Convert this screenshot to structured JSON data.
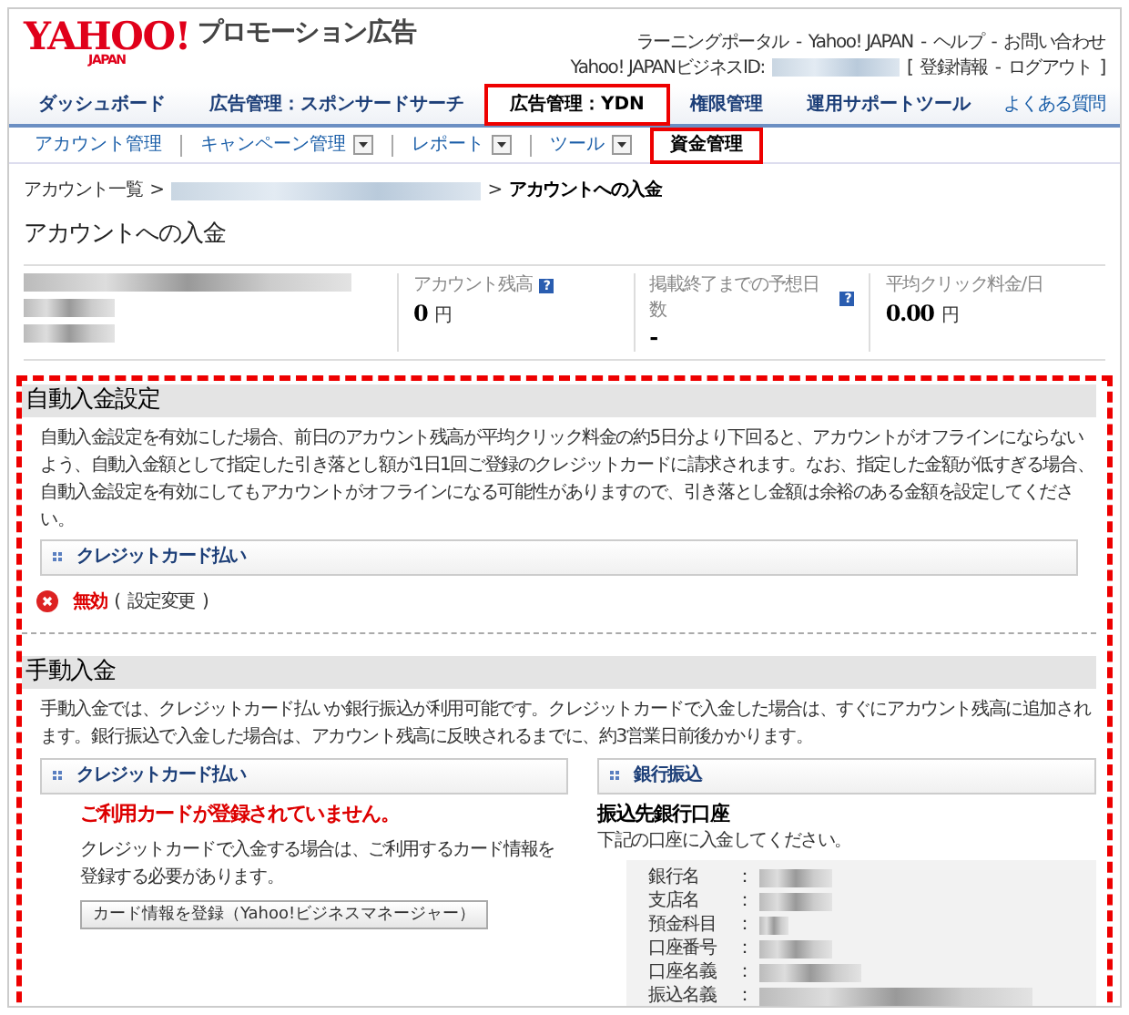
{
  "header": {
    "logo": "YAHOO!",
    "logo_sub": "JAPAN",
    "product": "プロモーション広告",
    "links": [
      {
        "text": "ラーニングポータル"
      },
      {
        "text": "Yahoo! JAPAN"
      },
      {
        "text": "ヘルプ"
      },
      {
        "text": "お問い合わせ"
      }
    ],
    "link_separator": "-",
    "business_id_label": "Yahoo! JAPANビジネスID:",
    "account_links": [
      {
        "text": "登録情報"
      },
      {
        "text": "ログアウト"
      }
    ],
    "bracket_open": "[",
    "bracket_close": "]"
  },
  "tabs": [
    {
      "label": "ダッシュボード",
      "selected": false,
      "highlighted": false
    },
    {
      "label": "広告管理：スポンサードサーチ",
      "selected": false,
      "highlighted": false
    },
    {
      "label": "広告管理：YDN",
      "selected": true,
      "highlighted": true
    },
    {
      "label": "権限管理",
      "selected": false,
      "highlighted": false
    },
    {
      "label": "運用サポートツール",
      "selected": false,
      "highlighted": false
    }
  ],
  "faq": "よくある質問",
  "subtabs": [
    {
      "label": "アカウント管理",
      "dropdown": false,
      "selected": false,
      "highlighted": false
    },
    {
      "label": "キャンペーン管理",
      "dropdown": true,
      "selected": false,
      "highlighted": false
    },
    {
      "label": "レポート",
      "dropdown": true,
      "selected": false,
      "highlighted": false
    },
    {
      "label": "ツール",
      "dropdown": true,
      "selected": false,
      "highlighted": false
    },
    {
      "label": "資金管理",
      "dropdown": false,
      "selected": true,
      "highlighted": true
    }
  ],
  "breadcrumb": [
    {
      "text": "アカウント一覧",
      "kind": "link"
    },
    {
      "kind": "redacted"
    },
    {
      "text": "アカウントへの入金",
      "kind": "current"
    }
  ],
  "breadcrumb_separator": ">",
  "page_title": "アカウントへの入金",
  "stats": [
    {
      "label": "アカウント残高",
      "help": "?",
      "value": "0",
      "unit": "円"
    },
    {
      "label": "掲載終了までの予想日数",
      "help": "?",
      "value": "-"
    },
    {
      "label": "平均クリック料金/日",
      "value": "0.00",
      "unit": "円"
    }
  ],
  "auto_deposit": {
    "heading": "自動入金設定",
    "text": "自動入金設定を有効にした場合、前日のアカウント残高が平均クリック料金の約5日分より下回ると、アカウントがオフラインにならないよう、自動入金額として指定した引き落とし額が1日1回ご登録のクレジットカードに請求されます。なお、指定した金額が低すぎる場合、自動入金設定を有効にしてもアカウントがオフラインになる可能性がありますので、引き落とし金額は余裕のある金額を設定してください。",
    "panel_title": "クレジットカード払い",
    "enabled": false,
    "status": "無効",
    "link_open": "(",
    "link": "設定変更",
    "link_close": ")"
  },
  "manual_deposit": {
    "heading": "手動入金",
    "text": "手動入金では、クレジットカード払いか銀行振込が利用可能です。クレジットカードで入金した場合は、すぐにアカウント残高に追加されます。銀行振込で入金した場合は、アカウント残高に反映されるまでに、約3営業日前後かかります。",
    "card": {
      "panel_title": "クレジットカード払い",
      "warning": "ご利用カードが登録されていません。",
      "text": "クレジットカードで入金する場合は、ご利用するカード情報を登録する必要があります。",
      "button": "カード情報を登録（Yahoo!ビジネスマネージャー）"
    },
    "bank": {
      "panel_title": "銀行振込",
      "subheading": "振込先銀行口座",
      "text": "下記の口座に入金してください。",
      "rows": [
        {
          "label": "銀行名",
          "sep": "："
        },
        {
          "label": "支店名",
          "sep": "："
        },
        {
          "label": "預金科目",
          "sep": "："
        },
        {
          "label": "口座番号",
          "sep": "："
        },
        {
          "label": "口座名義",
          "sep": "："
        },
        {
          "label": "振込名義",
          "sep": "："
        }
      ]
    }
  }
}
